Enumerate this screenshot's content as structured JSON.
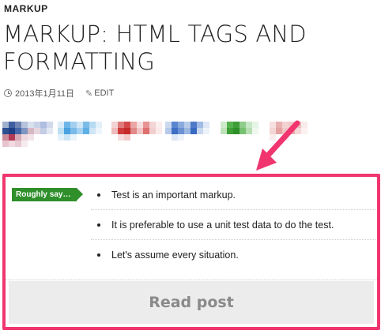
{
  "category": "MARKUP",
  "title": "MARKUP: HTML TAGS AND FORMATTING",
  "meta": {
    "date": "2013年1月11日",
    "edit_label": "EDIT"
  },
  "summary": {
    "tag_label": "Roughly say…",
    "points": [
      "Test is an important markup.",
      "It is preferable to use a unit test data to do the test.",
      "Let's assume every situation."
    ],
    "read_post_label": "Read post"
  },
  "colors": {
    "highlight": "#f0356f",
    "tag_bg": "#2e8f2b",
    "read_post_bg": "#ececec"
  }
}
